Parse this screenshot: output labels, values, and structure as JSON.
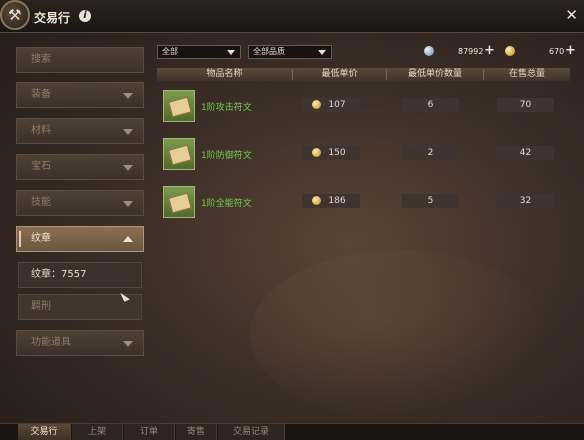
{
  "window": {
    "title": "交易行"
  },
  "sidebar": {
    "items": [
      {
        "label": "搜索",
        "has_arrow": false
      },
      {
        "label": "装备",
        "has_arrow": true
      },
      {
        "label": "材料",
        "has_arrow": true
      },
      {
        "label": "宝石",
        "has_arrow": true
      },
      {
        "label": "技能",
        "has_arrow": true
      },
      {
        "label": "纹章",
        "has_arrow": true,
        "active": true
      }
    ],
    "sub_items": [
      {
        "label": "纹章：7557"
      },
      {
        "label": "羁刑"
      },
      {
        "label": "功能道具"
      }
    ]
  },
  "filters": {
    "category": "全部",
    "quality": "全部品质"
  },
  "currency": {
    "silver": "87992",
    "gold": "670"
  },
  "table": {
    "headers": [
      "物品名称",
      "最低单价",
      "最低单价数量",
      "在售总量"
    ],
    "rows": [
      {
        "name": "1阶攻击符文",
        "price": "107",
        "qty": "6",
        "total": "70"
      },
      {
        "name": "1阶防御符文",
        "price": "150",
        "qty": "2",
        "total": "42"
      },
      {
        "name": "1阶全能符文",
        "price": "186",
        "qty": "5",
        "total": "32"
      }
    ]
  },
  "tabs": [
    {
      "label": "交易行",
      "active": true
    },
    {
      "label": "上架"
    },
    {
      "label": "订单"
    },
    {
      "label": "寄售"
    },
    {
      "label": "交易记录"
    }
  ],
  "colors": {
    "item_name": "#6fd04d",
    "accent": "#b29574"
  },
  "icons": {
    "close": "close-icon",
    "info": "info-icon",
    "silver": "silver-coin-icon",
    "gold": "gold-coin-icon"
  }
}
